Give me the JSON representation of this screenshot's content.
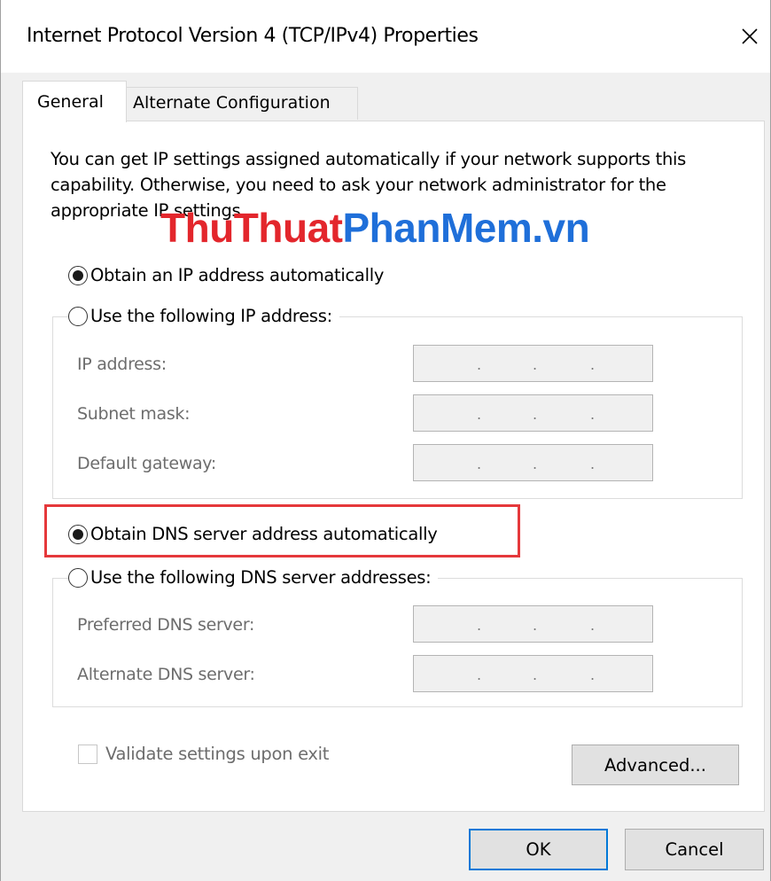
{
  "window": {
    "title": "Internet Protocol Version 4 (TCP/IPv4) Properties",
    "close_symbol": "×"
  },
  "tabs": [
    {
      "label": "General",
      "selected": true
    },
    {
      "label": "Alternate Configuration",
      "selected": false
    }
  ],
  "intro_text": "You can get IP settings assigned automatically if your network supports this capability. Otherwise, you need to ask your network administrator for the appropriate IP settings.",
  "watermark": {
    "part1": "ThuThuat",
    "part2": "PhanMem.vn",
    "part1_color": "#e3262c",
    "part2_color": "#1f6fd9"
  },
  "ip_settings": {
    "obtain_auto_label": "Obtain an IP address automatically",
    "obtain_auto_selected": true,
    "use_following_label": "Use the following IP address:",
    "use_following_selected": false,
    "fields": [
      {
        "label": "IP address:",
        "value": ". . ."
      },
      {
        "label": "Subnet mask:",
        "value": ". . ."
      },
      {
        "label": "Default gateway:",
        "value": ". . ."
      }
    ]
  },
  "dns_settings": {
    "obtain_auto_label": "Obtain DNS server address automatically",
    "obtain_auto_selected": true,
    "use_following_label": "Use the following DNS server addresses:",
    "use_following_selected": false,
    "fields": [
      {
        "label": "Preferred DNS server:",
        "value": ". . ."
      },
      {
        "label": "Alternate DNS server:",
        "value": ". . ."
      }
    ]
  },
  "validate_label": "Validate settings upon exit",
  "validate_checked": false,
  "buttons": {
    "advanced": "Advanced...",
    "ok": "OK",
    "cancel": "Cancel"
  },
  "colors": {
    "highlight_border": "#e5383b",
    "ok_button_border": "#0078d7",
    "disabled_text": "#6d6d6d"
  }
}
